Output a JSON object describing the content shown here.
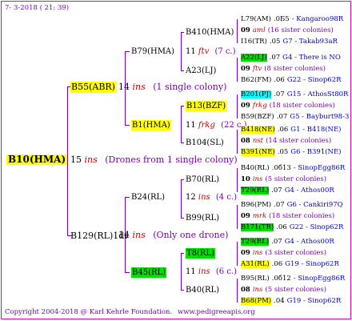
{
  "header": {
    "date": "7-  3-2018 ( 21: 39)"
  },
  "footer": {
    "left": "Copyright 2004-2018 @ Karl Kehrle Foundation.",
    "right": "www.pedigreeapis.org"
  },
  "root": {
    "label": "B10(HMA)",
    "num": "15",
    "ins": "ins",
    "note": "(Drones from 1 single colony)"
  },
  "g1": [
    {
      "label": "B55(ABR)",
      "num": "14",
      "ins": "ins",
      "note": "(1 single colony)"
    },
    {
      "label": "B129(RL)1dr",
      "num": "14",
      "ins": "ins",
      "note": "(Only one drone)"
    }
  ],
  "g2": [
    {
      "label": "B79(HMA)"
    },
    {
      "label": "B1(HMA)",
      "num": "11",
      "ins": "frkg",
      "note": "(22 c.)"
    },
    {
      "label": "B24(RL)",
      "num": "12",
      "ins": "ins",
      "note": "(4 c.)"
    },
    {
      "label": "B45(RL)",
      "num": "11",
      "ins": "ins",
      "note": "(6 c.)"
    }
  ],
  "g3": [
    {
      "label": "B410(HMA)",
      "num": "11",
      "ins": "ftv",
      "note": "(7 c.)"
    },
    {
      "label": "A23(LJ)"
    },
    {
      "label": "B13(BZF)",
      "num": "11",
      "ins": "frkg",
      "note": "(22 c.)"
    },
    {
      "label": "B104(SL)"
    },
    {
      "label": "B70(RL)",
      "num": "12",
      "ins": "ins",
      "note": "(4 c.)"
    },
    {
      "label": "B99(RL)"
    },
    {
      "label": "T8(RL)",
      "num": "11",
      "ins": "ins",
      "note": "(6 c.)"
    },
    {
      "label": "B40(RL)"
    }
  ],
  "g4": [
    {
      "a": "L79(AM)",
      "b": ".0Б5",
      "c": "- Kangaroo98R"
    },
    {
      "a": "09",
      "ins": "aml",
      "note": "(16 sister colonies)"
    },
    {
      "a": "I16(TR)",
      "b": ".05",
      "c": "G7 - Takab93aR"
    },
    {
      "a": "A22(LJ)",
      "b": ".07",
      "c": "G4 - There is NO"
    },
    {
      "a": "09",
      "ins": "ftv",
      "note": "(8 sister colonies)"
    },
    {
      "a": "B62(FM)",
      "b": ".06",
      "c": "G22 - Sinop62R"
    },
    {
      "a": "B201(PJ)",
      "b": ".07",
      "c": "G15 - AthosSt80R"
    },
    {
      "a": "09",
      "ins": "frkg",
      "note": "(18 sister colonies)"
    },
    {
      "a": "B59(BZF)",
      "b": ".07",
      "c": "G5 - Bayburt98-3"
    },
    {
      "a": "B418(NE)",
      "b": ".06",
      "c": "G1 - B418(NE)"
    },
    {
      "a": "08",
      "ins": "nst",
      "note": "(14 sister colonies)"
    },
    {
      "a": "B391(NE)",
      "b": ".05",
      "c": "G6 - B391(NE)"
    },
    {
      "a": "B40(RL)",
      "b": ".0б13",
      "c": "- SinopEgg86R"
    },
    {
      "a": "10",
      "ins": "ins",
      "note": "(5 sister colonies)"
    },
    {
      "a": "T29(RL)",
      "b": ".07",
      "c": "G4 - Athos00R"
    },
    {
      "a": "B96(PM)",
      "b": ".07",
      "c": "G6 - Cankiri97Q"
    },
    {
      "a": "09",
      "ins": "mrk",
      "note": "(18 sister colonies)"
    },
    {
      "a": "B171(TR)",
      "b": ".06",
      "c": "G22 - Sinop62R"
    },
    {
      "a": "T29(RL)",
      "b": ".07",
      "c": "G4 - Athos00R"
    },
    {
      "a": "09",
      "ins": "ins",
      "note": "(3 sister colonies)"
    },
    {
      "a": "A31(RL)",
      "b": ".06",
      "c": "G19 - Sinop62R"
    },
    {
      "a": "B95(RL)",
      "b": ".0б12",
      "c": "- SinopEgg86R"
    },
    {
      "a": "08",
      "ins": "ins",
      "note": "(5 sister colonies)"
    },
    {
      "a": "B68(PM)",
      "b": ".04",
      "c": "G19 - Sinop62R"
    }
  ],
  "colors": {
    "line": "#7a00b0",
    "accent_red": "#d00000",
    "yellow": "#ffff00",
    "green": "#00e000",
    "cyan": "#00ffff"
  }
}
